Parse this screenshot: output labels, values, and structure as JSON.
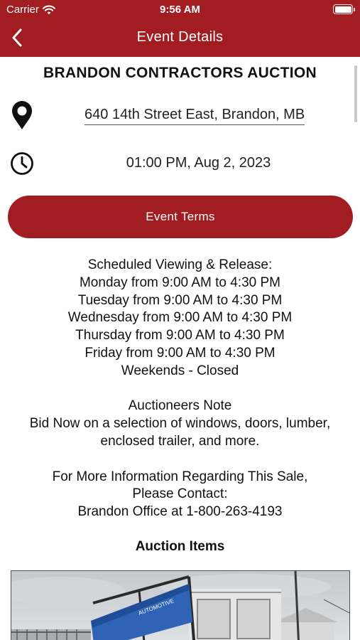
{
  "status_bar": {
    "carrier": "Carrier",
    "time": "9:56 AM"
  },
  "nav": {
    "title": "Event Details",
    "back_icon": "chevron-left-icon"
  },
  "event": {
    "title": "BRANDON CONTRACTORS AUCTION",
    "location_icon": "map-pin-icon",
    "address": "640 14th Street East, Brandon, MB",
    "time_icon": "clock-icon",
    "datetime": "01:00 PM, Aug 2, 2023",
    "terms_button": "Event Terms"
  },
  "description": {
    "viewing_heading": "Scheduled Viewing & Release:",
    "schedule": [
      "Monday from 9:00 AM to 4:30 PM",
      "Tuesday from 9:00 AM to 4:30 PM",
      "Wednesday from 9:00 AM to 4:30 PM",
      "Thursday from 9:00 AM to 4:30 PM",
      "Friday from 9:00 AM to 4:30 PM",
      "Weekends - Closed"
    ],
    "note_heading": "Auctioneers Note",
    "note_lines": [
      "Bid Now on a selection of windows, doors, lumber,",
      "enclosed trailer, and more."
    ],
    "contact_lines": [
      "For More Information Regarding This Sale,",
      "Please Contact:",
      "Brandon Office at 1-800-263-4193"
    ]
  },
  "items": {
    "heading": "Auction Items",
    "first_item_sign_words": [
      "AUTOMOTIVE"
    ]
  },
  "colors": {
    "brand": "#a11d22",
    "text": "#111111",
    "background": "#ffffff"
  }
}
